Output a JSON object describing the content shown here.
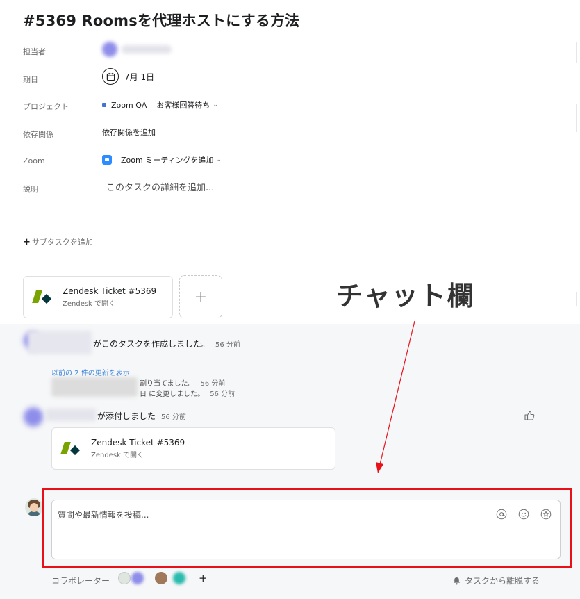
{
  "task": {
    "title": "#5369 Roomsを代理ホストにする方法"
  },
  "fields": {
    "assignee": {
      "label": "担当者"
    },
    "due_date": {
      "label": "期日",
      "value": "7月 1日"
    },
    "project": {
      "label": "プロジェクト",
      "name": "Zoom QA",
      "status": "お客様回答待ち"
    },
    "dependencies": {
      "label": "依存関係",
      "value": "依存関係を追加"
    },
    "zoom": {
      "label": "Zoom",
      "value": "Zoom ミーティングを追加"
    },
    "description": {
      "label": "説明",
      "placeholder": "このタスクの詳細を追加..."
    }
  },
  "subtask": {
    "label": "サブタスクを追加",
    "plus": "+"
  },
  "attachments": [
    {
      "title": "Zendesk Ticket #5369",
      "subtitle": "Zendesk で開く"
    }
  ],
  "add_attachment": "+",
  "annotation": {
    "text": "チャット欄",
    "color": "#e8111a"
  },
  "feed": {
    "created": {
      "text": "がこのタスクを作成しました。",
      "time": "56 分前"
    },
    "show_updates": "以前の 2 件の更新を表示",
    "update1": {
      "text": "割り当てました。",
      "time": "56 分前"
    },
    "update2": {
      "text": "日 に変更しました。",
      "time": "56 分前"
    },
    "attached": {
      "text": "が添付しました",
      "time": "56 分前"
    },
    "attachment": {
      "title": "Zendesk Ticket #5369",
      "subtitle": "Zendesk で開く"
    }
  },
  "comment": {
    "placeholder": "質問や最新情報を投稿..."
  },
  "footer": {
    "collaborators_label": "コラボレーター",
    "add_collaborator": "+",
    "leave_task": "タスクから離脱する"
  },
  "colors": {
    "accent_red": "#e8111a",
    "project_dot": "#4573d2",
    "zoom_blue": "#2d8cff",
    "link_blue": "#3b84d9"
  }
}
